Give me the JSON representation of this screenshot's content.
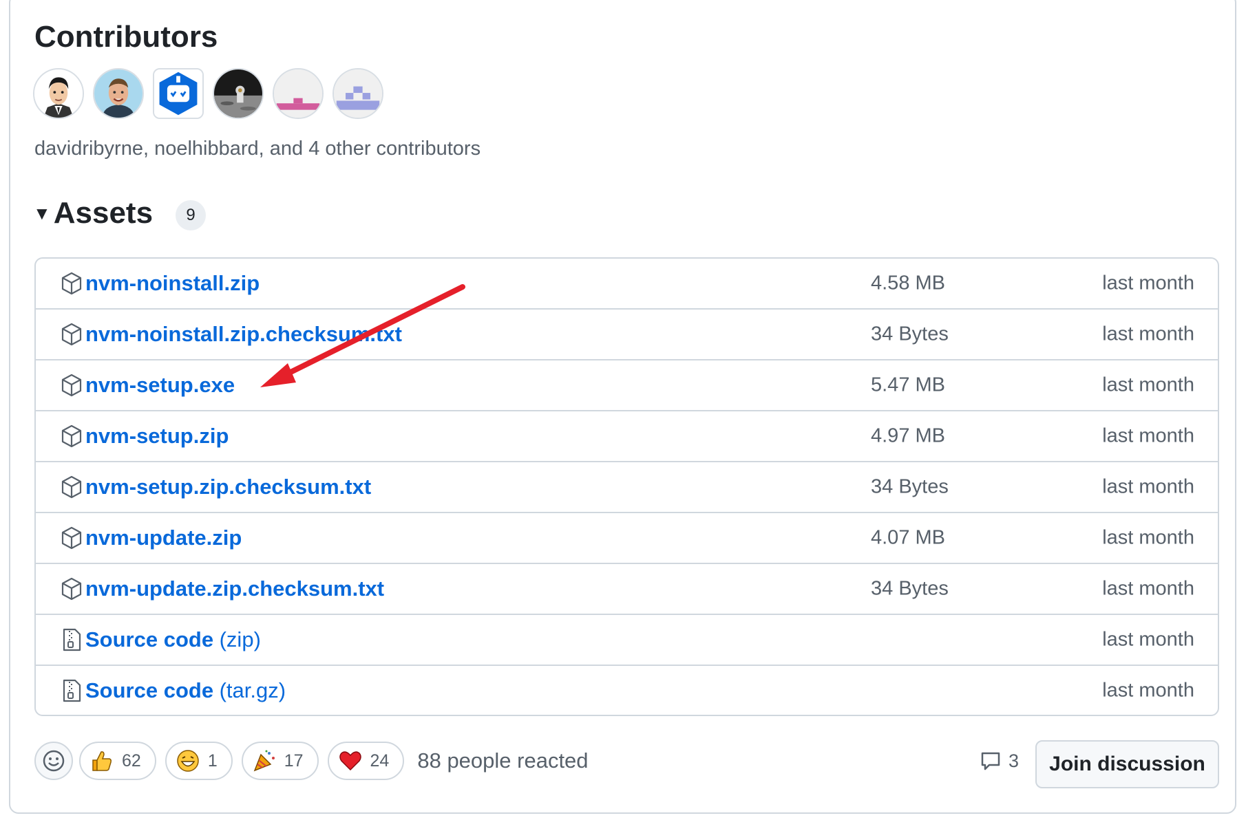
{
  "contributors": {
    "title": "Contributors",
    "summary": "davidribyrne, noelhibbard, and 4 other contributors",
    "avatars": [
      "avatar-cartoon-man",
      "avatar-smiling-man",
      "avatar-bot",
      "avatar-moon-landing",
      "avatar-pink-identicon",
      "avatar-lavender-identicon"
    ]
  },
  "assets": {
    "title": "Assets",
    "count": "9",
    "items": [
      {
        "name": "nvm-noinstall.zip",
        "suffix": "",
        "size": "4.58 MB",
        "date": "last month",
        "icon": "package-icon"
      },
      {
        "name": "nvm-noinstall.zip.checksum.txt",
        "suffix": "",
        "size": "34 Bytes",
        "date": "last month",
        "icon": "package-icon"
      },
      {
        "name": "nvm-setup.exe",
        "suffix": "",
        "size": "5.47 MB",
        "date": "last month",
        "icon": "package-icon"
      },
      {
        "name": "nvm-setup.zip",
        "suffix": "",
        "size": "4.97 MB",
        "date": "last month",
        "icon": "package-icon"
      },
      {
        "name": "nvm-setup.zip.checksum.txt",
        "suffix": "",
        "size": "34 Bytes",
        "date": "last month",
        "icon": "package-icon"
      },
      {
        "name": "nvm-update.zip",
        "suffix": "",
        "size": "4.07 MB",
        "date": "last month",
        "icon": "package-icon"
      },
      {
        "name": "nvm-update.zip.checksum.txt",
        "suffix": "",
        "size": "34 Bytes",
        "date": "last month",
        "icon": "package-icon"
      },
      {
        "name": "Source code",
        "suffix": " (zip)",
        "size": "",
        "date": "last month",
        "icon": "file-zip-icon"
      },
      {
        "name": "Source code",
        "suffix": " (tar.gz)",
        "size": "",
        "date": "last month",
        "icon": "file-zip-icon"
      }
    ]
  },
  "reactions": {
    "add_icon": "smiley-icon",
    "items": [
      {
        "emoji": "thumbs-up-icon",
        "count": "62"
      },
      {
        "emoji": "laugh-icon",
        "count": "1"
      },
      {
        "emoji": "party-popper-icon",
        "count": "17"
      },
      {
        "emoji": "heart-icon",
        "count": "24"
      }
    ],
    "summary": "88 people reacted"
  },
  "discussion": {
    "comment_icon": "comment-icon",
    "comment_count": "3",
    "join_label": "Join discussion"
  },
  "annotation": {
    "arrow_color": "#e5202a",
    "arrow_target": "nvm-setup.exe"
  },
  "colors": {
    "link": "#0969da",
    "muted": "#57606a",
    "border": "#d0d7de"
  }
}
